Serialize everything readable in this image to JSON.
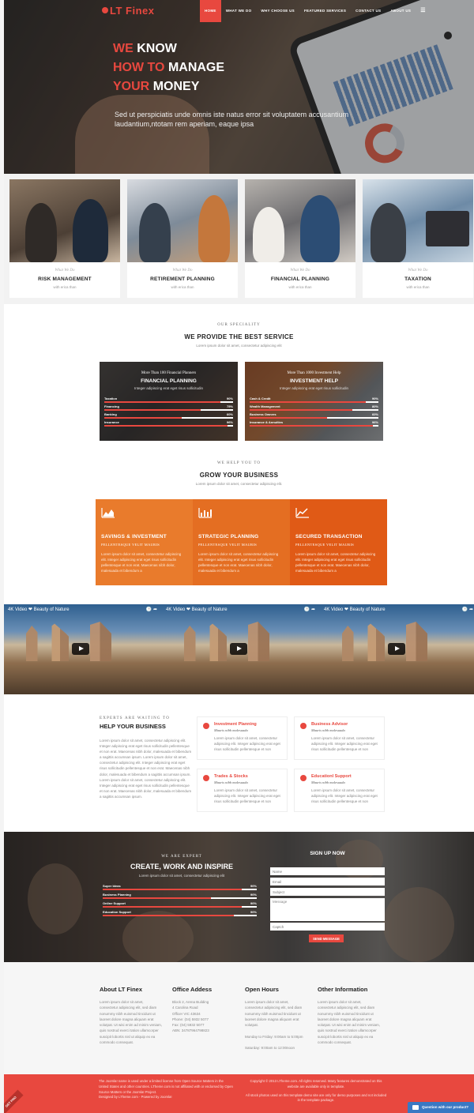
{
  "header": {
    "logo": "LT Finex",
    "nav": [
      "HOME",
      "WHAT WE DO",
      "WHY CHOOSE US",
      "FEATURED SERVICES",
      "CONTACT US",
      "ABOUT US"
    ],
    "menu_icon": "hamburger-icon"
  },
  "hero": {
    "line1_red": "WE",
    "line1_white": "KNOW",
    "line2_red": "HOW TO",
    "line2_white": "MANAGE",
    "line3_red": "YOUR",
    "line3_white": "MONEY",
    "subtitle": "Sed ut perspiciatis unde omnis iste natus error sit voluptatem accusantium laudantium,ntotam rem aperiam, eaque ipsa"
  },
  "services": [
    {
      "tag": "What We Do",
      "title": "RISK MANAGEMENT",
      "desc": "with erica than"
    },
    {
      "tag": "What We Do",
      "title": "RETIREMENT PLANNING",
      "desc": "with erica than"
    },
    {
      "tag": "What We Do",
      "title": "FINANCIAL PLANNING",
      "desc": "with erica than"
    },
    {
      "tag": "What We Do",
      "title": "TAXATION",
      "desc": "with erica than"
    }
  ],
  "speciality": {
    "kicker": "OUR SPECIALITY",
    "title": "WE PROVIDE THE BEST SERVICE",
    "subtitle": "Lorem ipsum dolor sit amet, consectetur adipiscing elit",
    "panels": [
      {
        "pre": "More Than 100 Financial Planners",
        "title": "FINANCIAL PLANNING",
        "sub": "Integer adipiscing erat eget risus sollicitudin",
        "skills": [
          {
            "label": "Taxation",
            "pct": "90%",
            "value": 90
          },
          {
            "label": "Financing",
            "pct": "75%",
            "value": 75
          },
          {
            "label": "Banking",
            "pct": "60%",
            "value": 60
          },
          {
            "label": "Insurance",
            "pct": "96%",
            "value": 96
          }
        ]
      },
      {
        "pre": "More Than 1000 Investment Help",
        "title": "INVESTMENT HELP",
        "sub": "Integer adipiscing erat eget risus sollicitudin",
        "skills": [
          {
            "label": "Cash & Credit",
            "pct": "90%",
            "value": 90
          },
          {
            "label": "Wealth Management",
            "pct": "80%",
            "value": 80
          },
          {
            "label": "Business Owners",
            "pct": "60%",
            "value": 60
          },
          {
            "label": "Insurance & Annuities",
            "pct": "96%",
            "value": 96
          }
        ]
      }
    ]
  },
  "grow": {
    "kicker": "WE HELP YOU TO",
    "title": "GROW YOUR BUSINESS",
    "subtitle": "Lorem ipsum dolor sit amet, consectetur adipiscing elit.",
    "cols": [
      {
        "icon": "area-chart-icon",
        "title": "SAVINGS & INVESTMENT",
        "sub": "PELLENTESQUE VELIT MAURIS",
        "desc": "Lorem ipsum dolor sit amet, consectetur adipiscing elit. Integer adipiscing erat eget risus sollicitudin pellentesque et non erat. Maecenas nibh dolor, malesuada et bibendum a"
      },
      {
        "icon": "bar-chart-icon",
        "title": "STRATEGIC PLANNING",
        "sub": "PELLENTESQUE VELIT MAURIS",
        "desc": "Lorem ipsum dolor sit amet, consectetur adipiscing elit. Integer adipiscing erat eget risus sollicitudin pellentesque et non erat. Maecenas nibh dolor, malesuada et bibendum a"
      },
      {
        "icon": "line-chart-icon",
        "title": "SECURED TRANSACTION",
        "sub": "PELLENTESQUE VELIT MAURIS",
        "desc": "Lorem ipsum dolor sit amet, consectetur adipiscing elit. Integer adipiscing erat eget risus sollicitudin pellentesque et non erat. Maecenas nibh dolor, malesuada et bibendum a"
      }
    ]
  },
  "videos": [
    {
      "title": "4K Video ❤ Beauty of Nature"
    },
    {
      "title": "4K Video ❤ Beauty of Nature"
    },
    {
      "title": "4K Video ❤ Beauty of Nature"
    }
  ],
  "experts": {
    "kicker": "EXPERTS ARE WAITING TO",
    "title": "HELP YOUR BUSINESS",
    "text": "Lorem ipsum dolor sit amet, consectetur adipiscing elit. Integer adipiscing erat eget risus sollicitudin pellentesque et non erat. Maecenas nibh dolor, malesuada et bibendum a sagittis accumsan ipsum. Lorem ipsum dolor sit amet, consectetur adipiscing elit. Integer adipiscing erat eget risus sollicitudin pellentesque et non erat. Maecenas nibh dolor, malesuada et bibendum a sagittis accumsan ipsum. Lorem ipsum dolor sit amet, consectetur adipiscing elit. Integer adipiscing erat eget risus sollicitudin pellentesque et non erat. Maecenas nibh dolor, malesuada et bibendum a sagittis accumsan ipsum.",
    "boxes": [
      {
        "title": "Investment Planning",
        "sub": "Mauris nibh malesuada",
        "desc": "Lorem ipsum dolor sit amet, consectetur adipiscing elit. Integer adipiscing erat eget risus sollicitudin pellentesque et non"
      },
      {
        "title": "Business Advisor",
        "sub": "Mauris nibh malesuada",
        "desc": "Lorem ipsum dolor sit amet, consectetur adipiscing elit. Integer adipiscing erat eget risus sollicitudin pellentesque et non"
      },
      {
        "title": "Trades & Stocks",
        "sub": "Mauris nibh malesuada",
        "desc": "Lorem ipsum dolor sit amet, consectetur adipiscing elit. Integer adipiscing erat eget risus sollicitudin pellentesque et non"
      },
      {
        "title": "Educationl Support",
        "sub": "Mauris nibh malesuada",
        "desc": "Lorem ipsum dolor sit amet, consectetur adipiscing elit. Integer adipiscing erat eget risus sollicitudin pellentesque et non"
      }
    ]
  },
  "create": {
    "kicker": "WE ARE EXPERT",
    "title": "CREATE, WORK AND INSPIRE",
    "subtitle": "Lorem ipsum dolor sit amet, consectetur adipiscing elit",
    "skills": [
      {
        "label": "Super Ideas",
        "pct": "90%",
        "value": 90
      },
      {
        "label": "Business Planning",
        "pct": "90%",
        "value": 70
      },
      {
        "label": "Online Support",
        "pct": "90%",
        "value": 90
      },
      {
        "label": "Education Support",
        "pct": "90%",
        "value": 85
      }
    ],
    "signup": {
      "title": "SIGN UP NOW",
      "name_placeholder": "Name",
      "email_placeholder": "Email",
      "subject_placeholder": "Subject",
      "message_placeholder": "Message",
      "captcha_placeholder": "Captch",
      "button": "SEND MESSAGE"
    }
  },
  "footer": {
    "cols": [
      {
        "title": "About LT Finex",
        "lines": [
          "Lorem ipsum dolor sit amet,",
          "consectetur adipiscing elit, sed diam",
          "nonummy nibh euismod tincidunt ut",
          "laoreet dolore magna aliquam erat",
          "volutpat. Ut wisi enim ad minim veniam,",
          "quis nostrud exerci tation ullamcorper",
          "suscipit lobortis nisl ut aliquip ex ea",
          "commodo consequat."
        ]
      },
      {
        "title": "Office Addess",
        "lines": [
          "Block 2, Arena Building",
          "4 Carolina Road",
          "Officer VIC 43634",
          "Phone: (04) 5932 5077",
          "Fax: (04) 5932 5077",
          "ABN: 34787964798823"
        ]
      },
      {
        "title": "Open Hours",
        "lines": [
          "Lorem ipsum dolor sit amet,",
          "consectetur adipiscing elit, sed diam",
          "nonummy nibh euismod tincidunt ut",
          "laoreet dolore magna aliquam erat",
          "volutpat.",
          "",
          "Monday to Friday: 9:00am to 5:00pm",
          "",
          "Saturday: 9:00am to 12:00noon"
        ]
      },
      {
        "title": "Other Information",
        "lines": [
          "Lorem ipsum dolor sit amet,",
          "consectetur adipiscing elit, sed diam",
          "nonummy nibh euismod tincidunt ut",
          "laoreet dolore magna aliquam erat",
          "volutpat. Ut wisi enim ad minim veniam,",
          "quis nostrud exerci tation ullamcorper",
          "suscipit lobortis nisl ut aliquip ex ea",
          "commodo consequat."
        ]
      }
    ],
    "bottom_left": "The Joomla! name is used under a limited license from Open Source Matters in the United States and other countries. LTheme.com is not affiliated with or endorsed by Open Source Matters or the Joomla! Project.",
    "bottom_left_credit": "Designed by LTheme.com - Powered by Joomla!",
    "bottom_right": "Copyright © 2013 LTheme.com. All rights reserved. Many features demonstrated on this website are available only in template.",
    "bottom_right_2": "All stock photos used on this template demo site are only for demo purposes and not included in the template package.",
    "ribbon": "GET PRO",
    "chat": "Question with our product?"
  },
  "colors": {
    "accent": "#e8483f",
    "orange1": "#e97b2c",
    "orange2": "#e46e22",
    "orange3": "#e05a16",
    "chat": "#3a78c3"
  }
}
